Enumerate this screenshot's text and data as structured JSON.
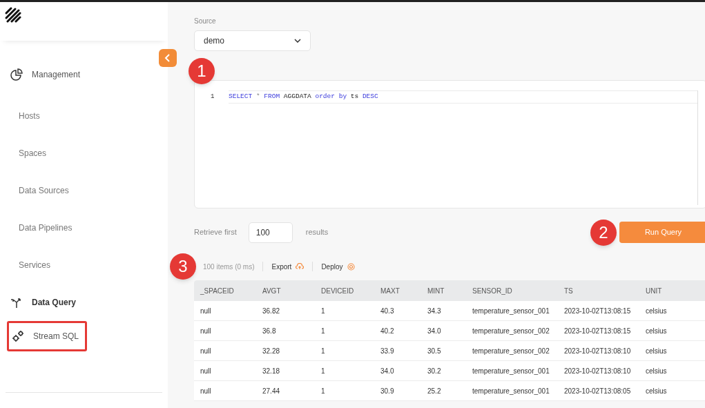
{
  "sidebar": {
    "items": [
      {
        "label": "Management",
        "kind": "section",
        "highlighted": false
      },
      {
        "label": "Hosts",
        "kind": "item",
        "highlighted": false
      },
      {
        "label": "Spaces",
        "kind": "item",
        "highlighted": false
      },
      {
        "label": "Data Sources",
        "kind": "item",
        "highlighted": false
      },
      {
        "label": "Data Pipelines",
        "kind": "item",
        "highlighted": false
      },
      {
        "label": "Services",
        "kind": "item",
        "highlighted": false
      },
      {
        "label": "Data Query",
        "kind": "group",
        "highlighted": false
      },
      {
        "label": "Stream SQL",
        "kind": "tool",
        "highlighted": true
      }
    ]
  },
  "source": {
    "label": "Source",
    "value": "demo"
  },
  "editor": {
    "line_number": "1",
    "tokens": [
      {
        "text": "SELECT",
        "kind": "keyword"
      },
      {
        "text": "*",
        "kind": "operator"
      },
      {
        "text": "FROM",
        "kind": "keyword"
      },
      {
        "text": "AGGDATA",
        "kind": "plain"
      },
      {
        "text": "order",
        "kind": "keyword"
      },
      {
        "text": "by",
        "kind": "keyword"
      },
      {
        "text": "ts",
        "kind": "plain"
      },
      {
        "text": "DESC",
        "kind": "keyword"
      }
    ]
  },
  "callouts": [
    "1",
    "2",
    "3"
  ],
  "retrieve": {
    "prefix": "Retrieve first",
    "value": "100",
    "suffix": "results"
  },
  "run_button": "Run Query",
  "results_toolbar": {
    "count": "100 items (0 ms)",
    "export": "Export",
    "deploy": "Deploy"
  },
  "table": {
    "columns": [
      "_SPACEID",
      "AVGT",
      "DEVICEID",
      "MAXT",
      "MINT",
      "SENSOR_ID",
      "TS",
      "UNIT"
    ],
    "rows": [
      [
        "null",
        "36.82",
        "1",
        "40.3",
        "34.3",
        "temperature_sensor_001",
        "2023-10-02T13:08:15",
        "celsius"
      ],
      [
        "null",
        "36.8",
        "1",
        "40.2",
        "34.0",
        "temperature_sensor_002",
        "2023-10-02T13:08:15",
        "celsius"
      ],
      [
        "null",
        "32.28",
        "1",
        "33.9",
        "30.5",
        "temperature_sensor_002",
        "2023-10-02T13:08:10",
        "celsius"
      ],
      [
        "null",
        "32.18",
        "1",
        "34.0",
        "30.2",
        "temperature_sensor_001",
        "2023-10-02T13:08:10",
        "celsius"
      ],
      [
        "null",
        "27.44",
        "1",
        "30.9",
        "25.2",
        "temperature_sensor_001",
        "2023-10-02T13:08:05",
        "celsius"
      ]
    ]
  }
}
